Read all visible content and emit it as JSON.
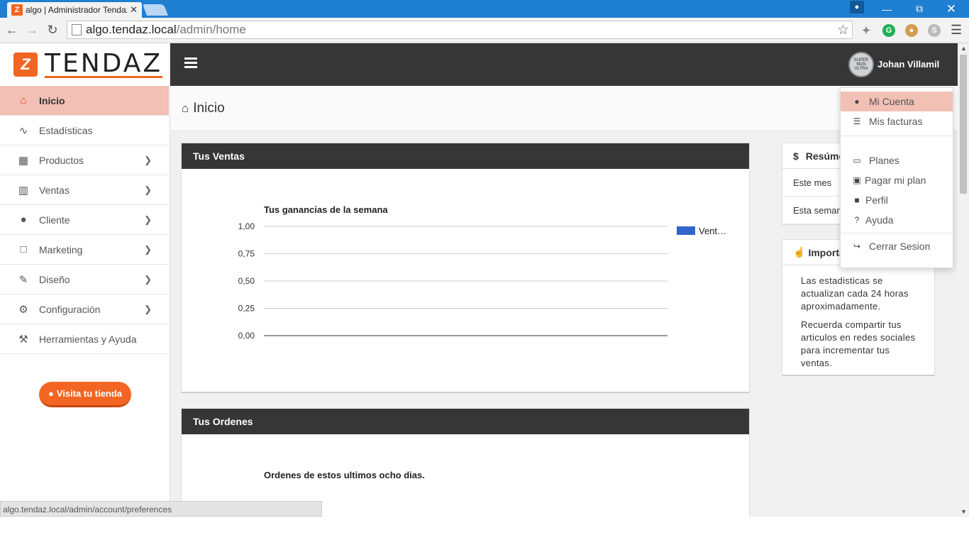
{
  "browser": {
    "tab_title": "algo | Administrador Tendaz",
    "tab_close": "✕",
    "url_host": "algo.tendaz.local",
    "url_path": "/admin/home",
    "status_url": "algo.tendaz.local/admin/account/preferences"
  },
  "logo": {
    "mark": "Z",
    "text": "TENDAZ",
    "color": "#f26522"
  },
  "sidebar": {
    "items": [
      {
        "label": "Inicio",
        "icon": "home-icon",
        "active": true
      },
      {
        "label": "Estadísticas",
        "icon": "line-chart-icon"
      },
      {
        "label": "Productos",
        "icon": "grid-icon",
        "has_submenu": true
      },
      {
        "label": "Ventas",
        "icon": "cart-icon",
        "has_submenu": true
      },
      {
        "label": "Cliente",
        "icon": "user-icon",
        "has_submenu": true
      },
      {
        "label": "Marketing",
        "icon": "chat-icon",
        "has_submenu": true
      },
      {
        "label": "Diseño",
        "icon": "pencil-icon",
        "has_submenu": true
      },
      {
        "label": "Configuración",
        "icon": "cogs-icon",
        "has_submenu": true
      },
      {
        "label": "Herramientas y Ayuda",
        "icon": "wrench-icon"
      }
    ],
    "visit_store": "Visita tu tienda"
  },
  "topbar": {
    "user_name": "Johan Villamil",
    "avatar_text": "SUPER MAN ULTRA"
  },
  "page": {
    "title": "Inicio"
  },
  "ventas": {
    "title": "Tus Ventas",
    "chart_data": {
      "type": "line",
      "title": "Tus ganancias de la semana",
      "y_ticks": [
        "1,00",
        "0,75",
        "0,50",
        "0,25",
        "0,00"
      ],
      "ylim": [
        0,
        1
      ],
      "series": [
        {
          "name": "Vent…",
          "values": [
            0,
            0,
            0,
            0,
            0,
            0,
            0
          ],
          "color": "#3366cc"
        }
      ],
      "legend": "right",
      "grid": true
    }
  },
  "ordenes": {
    "title": "Tus Ordenes",
    "subtitle": "Ordenes de estos ultimos ocho dias."
  },
  "resumen": {
    "title": "Resúmen",
    "rows": [
      "Este mes",
      "Esta semana"
    ]
  },
  "importante": {
    "title": "Importante",
    "p1": "Las estadisticas se actualizan cada 24 horas aproximadamente.",
    "p2": "Recuerda compartir tus articulos en redes sociales para incrementar tus ventas."
  },
  "dropdown": {
    "items": [
      {
        "label": "Mi Cuenta",
        "icon": "user-plus-icon",
        "active": true
      },
      {
        "label": "Mis facturas",
        "icon": "list-icon"
      },
      {
        "label": "Planes",
        "icon": "credit-card-icon"
      },
      {
        "label": "Pagar mi plan",
        "icon": "money-icon"
      },
      {
        "label": "Perfil",
        "icon": "lock-icon"
      },
      {
        "label": "Ayuda",
        "icon": "question-icon"
      },
      {
        "label": "Cerrar Sesion",
        "icon": "sign-out-icon"
      }
    ]
  }
}
